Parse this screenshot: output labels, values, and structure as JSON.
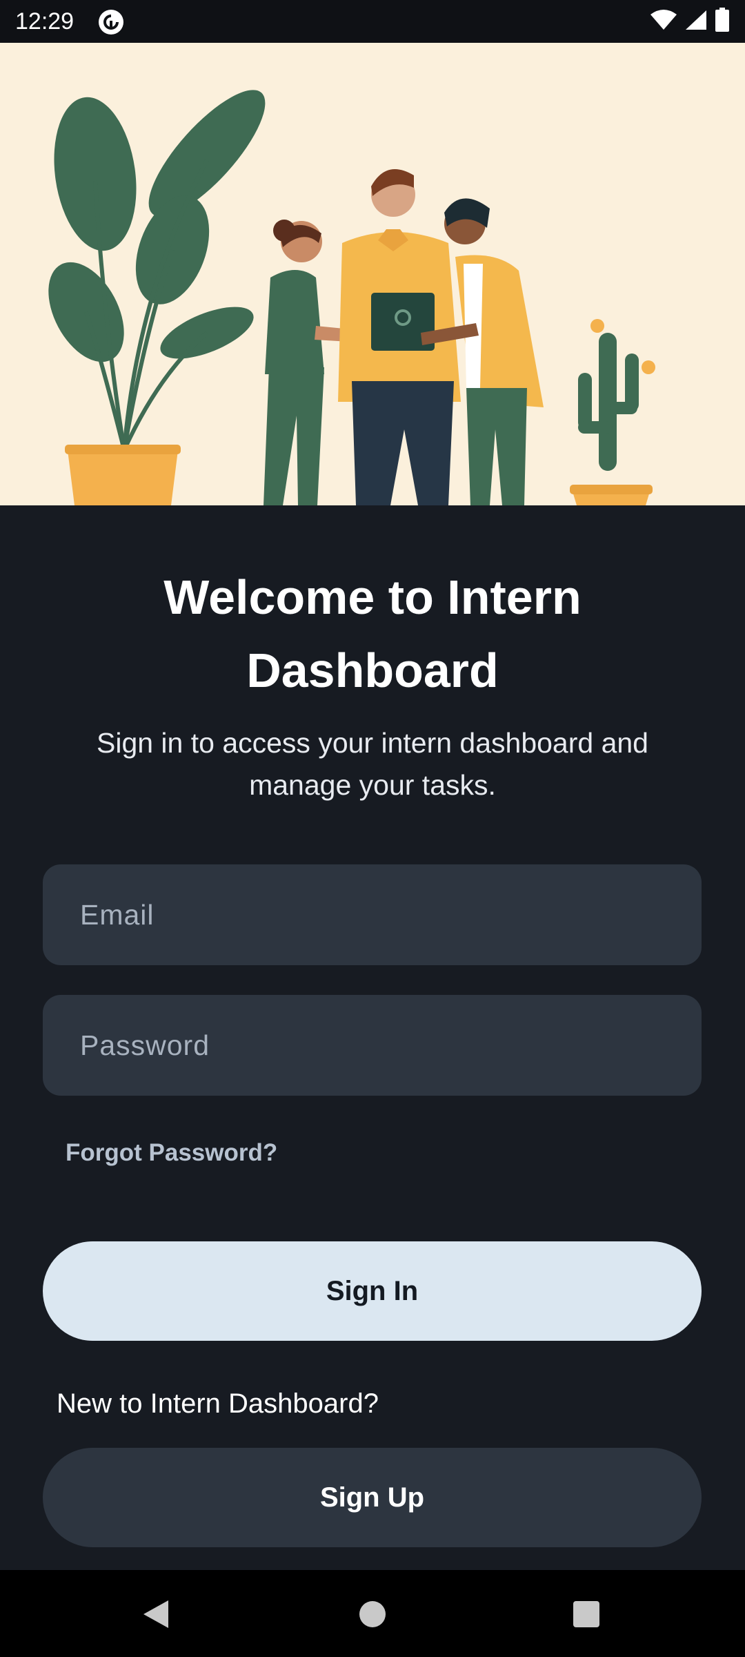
{
  "status_bar": {
    "time": "12:29",
    "app_icon": "pocket-casts-icon",
    "icons": [
      "wifi-icon",
      "signal-icon",
      "battery-icon"
    ]
  },
  "hero": {
    "illustration": "people-collaborating-illustration"
  },
  "welcome": {
    "title": "Welcome to Intern Dashboard",
    "subtitle": "Sign in to access your intern dashboard and manage your tasks."
  },
  "form": {
    "email_placeholder": "Email",
    "email_value": "",
    "password_placeholder": "Password",
    "password_value": "",
    "forgot_password_label": "Forgot Password?",
    "sign_in_label": "Sign In",
    "new_to_label": "New to Intern Dashboard?",
    "sign_up_label": "Sign Up"
  },
  "nav_bar": {
    "icons": [
      "back-icon",
      "home-icon",
      "recents-icon"
    ]
  },
  "colors": {
    "background": "#171b22",
    "input_background": "#2d3540",
    "sign_in_button": "#dbe7f1",
    "sign_up_button": "#2d3540",
    "hero_background": "#fbf0dc"
  }
}
